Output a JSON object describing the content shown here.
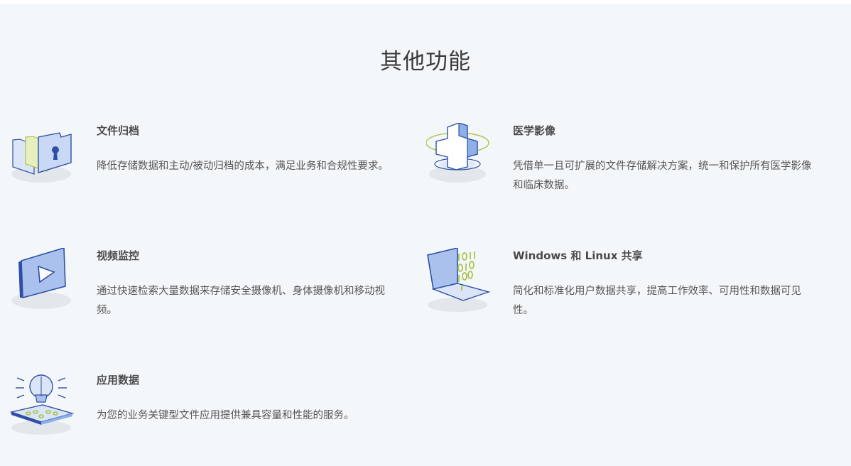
{
  "section": {
    "title": "其他功能"
  },
  "features": [
    {
      "icon": "file-archive-icon",
      "title": "文件归档",
      "description": "降低存储数据和主动/被动归档的成本，满足业务和合规性要求。"
    },
    {
      "icon": "medical-cross-icon",
      "title": "医学影像",
      "description": "凭借单一且可扩展的文件存储解决方案，统一和保护所有医学影像和临床数据。"
    },
    {
      "icon": "video-play-icon",
      "title": "视频监控",
      "description": "通过快速检索大量数据来存储安全摄像机、身体摄像机和移动视频。"
    },
    {
      "icon": "laptop-binary-icon",
      "title": "Windows 和 Linux 共享",
      "description": "简化和标准化用户数据共享，提高工作效率、可用性和数据可见性。"
    },
    {
      "icon": "lightbulb-app-icon",
      "title": "应用数据",
      "description": "为您的业务关键型文件应用提供兼具容量和性能的服务。"
    }
  ],
  "colors": {
    "background": "#f4f7fa",
    "accent_blue": "#2e4fa8",
    "light_blue": "#a9c1ec",
    "accent_green": "#a9c44a",
    "shadow": "#e3e6ea"
  }
}
